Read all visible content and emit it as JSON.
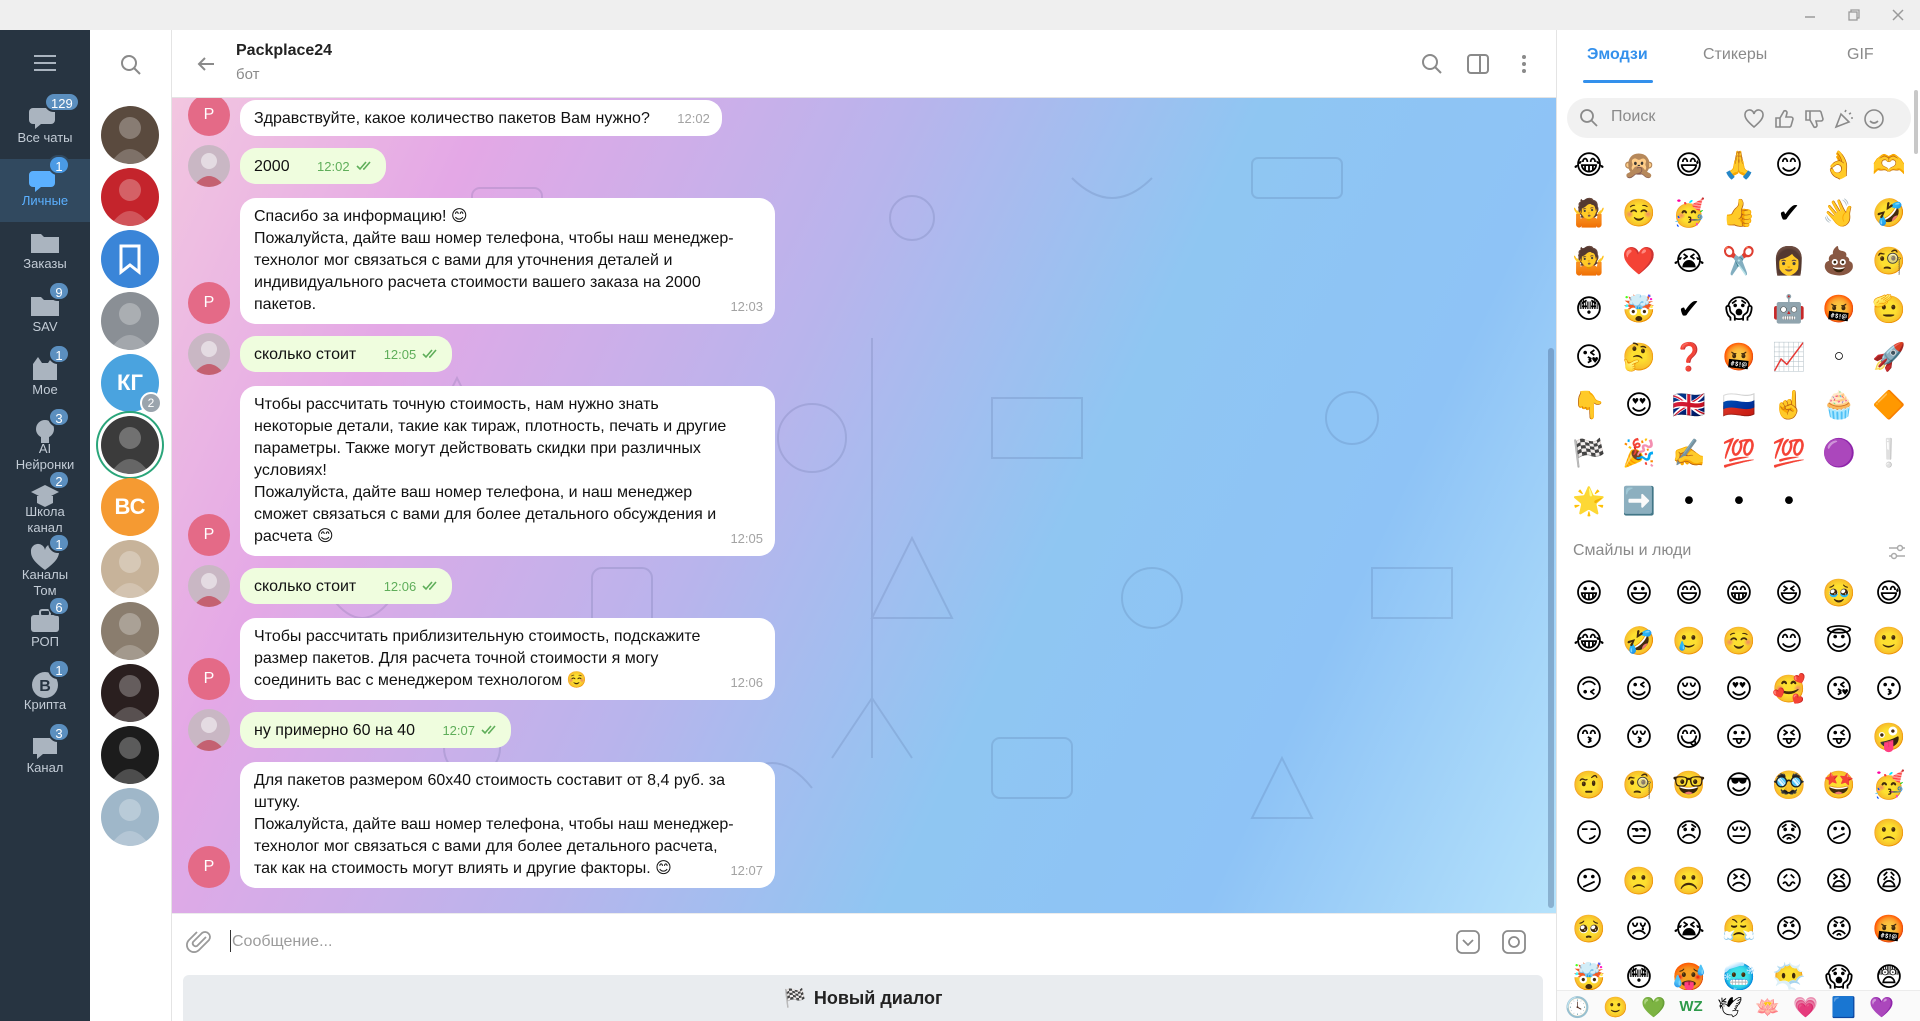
{
  "folders": [
    {
      "label": "Все чаты",
      "badge": "129",
      "icon": "chats-icon",
      "active": false
    },
    {
      "label": "Личные",
      "badge": "1",
      "icon": "personal-chats-icon",
      "active": true
    },
    {
      "label": "Заказы",
      "badge": "",
      "icon": "folder-icon",
      "active": false
    },
    {
      "label": "SAV",
      "badge": "9",
      "icon": "folder-icon",
      "active": false
    },
    {
      "label": "Мое",
      "badge": "1",
      "icon": "cat-icon",
      "active": false
    },
    {
      "label": "AI\nНейронки",
      "badge": "3",
      "icon": "bulb-icon",
      "active": false
    },
    {
      "label": "Школа\nканал",
      "badge": "2",
      "icon": "school-icon",
      "active": false
    },
    {
      "label": "Каналы\nТом",
      "badge": "1",
      "icon": "heart-icon",
      "active": false
    },
    {
      "label": "РОП",
      "badge": "6",
      "icon": "briefcase-icon",
      "active": false
    },
    {
      "label": "Крипта",
      "badge": "1",
      "icon": "bitcoin-icon",
      "active": false
    },
    {
      "label": "Канал",
      "badge": "3",
      "icon": "chat-folder-icon",
      "active": false
    }
  ],
  "chat_list": [
    {
      "type": "photo",
      "color": "#5a4a3e"
    },
    {
      "type": "photo",
      "color": "#c4242c"
    },
    {
      "type": "icon",
      "color": "#3a85d8"
    },
    {
      "type": "photo",
      "color": "#8a8f95"
    },
    {
      "type": "text",
      "text": "КГ",
      "color": "#4aa3df",
      "badge": "2"
    },
    {
      "type": "photo",
      "color": "#3b3b3b",
      "ring": true
    },
    {
      "type": "text",
      "text": "ВС",
      "color": "#f59a32"
    },
    {
      "type": "photo",
      "color": "#c7b39a"
    },
    {
      "type": "photo",
      "color": "#8a7d6e"
    },
    {
      "type": "photo",
      "color": "#2a1f1f"
    },
    {
      "type": "photo",
      "color": "#1c1c1c"
    },
    {
      "type": "photo",
      "color": "#9fb7c9"
    }
  ],
  "header": {
    "title": "Packplace24",
    "subtitle": "бот"
  },
  "messages": [
    {
      "dir": "in",
      "text": "Здравствуйте, какое количество пакетов Вам нужно?",
      "time": "12:02"
    },
    {
      "dir": "out",
      "text": "2000",
      "time": "12:02"
    },
    {
      "dir": "in",
      "text": "Спасибо за информацию! 😊\nПожалуйста, дайте ваш номер телефона, чтобы наш менеджер-\nтехнолог мог связаться с вами для уточнения деталей и\nиндивидуального расчета стоимости вашего заказа на 2000\nпакетов.",
      "time": "12:03"
    },
    {
      "dir": "out",
      "text": "сколько стоит",
      "time": "12:05"
    },
    {
      "dir": "in",
      "text": "Чтобы рассчитать точную стоимость, нам нужно знать\nнекоторые детали, такие как тираж, плотность, печать и другие\nпараметры. Также могут действовать скидки при различных\nусловиях!\nПожалуйста, дайте ваш номер телефона, и наш менеджер\nсможет связаться с вами для более детального обсуждения и\nрасчета 😊",
      "time": "12:05"
    },
    {
      "dir": "out",
      "text": "сколько стоит",
      "time": "12:06"
    },
    {
      "dir": "in",
      "text": "Чтобы рассчитать приблизительную стоимость, подскажите\nразмер пакетов. Для расчета точной стоимости я могу\nсоединить вас с менеджером технологом ☺️",
      "time": "12:06"
    },
    {
      "dir": "out",
      "text": "ну примерно 60 на 40",
      "time": "12:07"
    },
    {
      "dir": "in",
      "text": "Для пакетов размером 60x40 стоимость составит от 8,4 руб. за\nштуку.\nПожалуйста, дайте ваш номер телефона, чтобы наш менеджер-\nтехнолог мог связаться с вами для более детального расчета,\nтак как на стоимость могут влиять и другие факторы. 😊",
      "time": "12:07"
    }
  ],
  "bot_avatar_letter": "P",
  "input": {
    "placeholder": "Сообщение..."
  },
  "bot_button": {
    "flag": "🏁",
    "label": "Новый диалог"
  },
  "emoji_panel": {
    "tabs": [
      "Эмодзи",
      "Стикеры",
      "GIF"
    ],
    "search_placeholder": "Поиск",
    "recent": [
      "😂",
      "🙊",
      "😅",
      "🙏",
      "😊",
      "👌",
      "🫶",
      "🤷",
      "☺️",
      "🥳",
      "👍",
      "✔",
      "👋",
      "🤣",
      "🤷",
      "❤️",
      "😭",
      "✂️",
      "👩",
      "💩",
      "🧐",
      "😳",
      "🤯",
      "✔",
      "😱",
      "🤖",
      "🤬",
      "🫡",
      "😘",
      "🤔",
      "❓",
      "🤬",
      "📈",
      "◦",
      "🚀",
      "👇",
      "😍",
      "🇬🇧",
      "🇷🇺",
      "☝️",
      "🧁",
      "🔶",
      "🏁",
      "🎉",
      "✍️",
      "💯",
      "💯",
      "🟣",
      "❕",
      "🌟",
      "➡️",
      "•",
      "•",
      "•"
    ],
    "section_title": "Смайлы и люди",
    "people": [
      "😀",
      "😃",
      "😄",
      "😁",
      "😆",
      "🥹",
      "😅",
      "😂",
      "🤣",
      "🥲",
      "☺️",
      "😊",
      "😇",
      "🙂",
      "🙃",
      "😉",
      "😌",
      "😍",
      "🥰",
      "😘",
      "😗",
      "😙",
      "😚",
      "😋",
      "😛",
      "😝",
      "😜",
      "🤪",
      "🤨",
      "🧐",
      "🤓",
      "😎",
      "🥸",
      "🤩",
      "🥳",
      "😏",
      "😒",
      "😞",
      "😔",
      "😟",
      "😕",
      "🙁",
      "😕",
      "🙁",
      "☹️",
      "😣",
      "😖",
      "😫",
      "😩",
      "🥺",
      "😢",
      "😭",
      "😤",
      "😠",
      "😡",
      "🤬",
      "🤯",
      "😳",
      "🥵",
      "🥶",
      "😶‍🌫️",
      "😱",
      "😨"
    ],
    "bottom_icons": [
      "🕓",
      "🙂",
      "💚",
      "WZ",
      "🕊",
      "🪷",
      "💗",
      "🟦",
      "💜"
    ]
  }
}
